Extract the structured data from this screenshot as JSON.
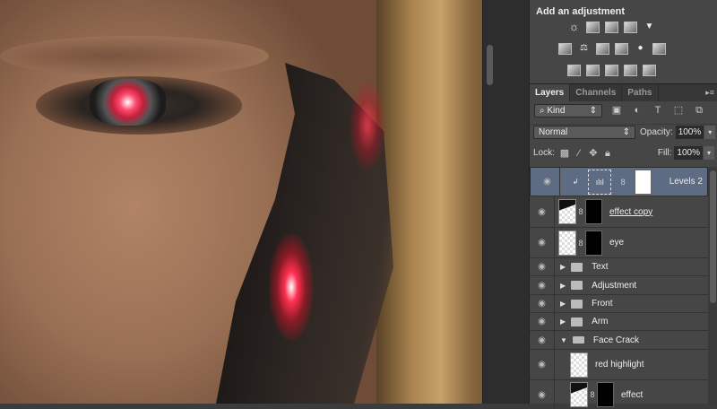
{
  "adjustments": {
    "title": "Add an adjustment"
  },
  "layers_panel": {
    "tabs": [
      "Layers",
      "Channels",
      "Paths"
    ],
    "filter": "Kind",
    "blend_mode": "Normal",
    "opacity_label": "Opacity:",
    "opacity": "100%",
    "lock_label": "Lock:",
    "fill_label": "Fill:",
    "fill": "100%",
    "layers": [
      {
        "name": "Levels 2",
        "type": "adjustment",
        "selected": true
      },
      {
        "name": "effect copy",
        "type": "pixel"
      },
      {
        "name": "eye",
        "type": "pixel"
      },
      {
        "name": "Text",
        "type": "group",
        "expanded": false
      },
      {
        "name": "Adjustment",
        "type": "group",
        "expanded": false
      },
      {
        "name": "Front",
        "type": "group",
        "expanded": false
      },
      {
        "name": "Arm",
        "type": "group",
        "expanded": false
      },
      {
        "name": "Face Crack",
        "type": "group",
        "expanded": true
      },
      {
        "name": "red highlight",
        "type": "pixel"
      },
      {
        "name": "effect",
        "type": "pixel"
      }
    ]
  }
}
